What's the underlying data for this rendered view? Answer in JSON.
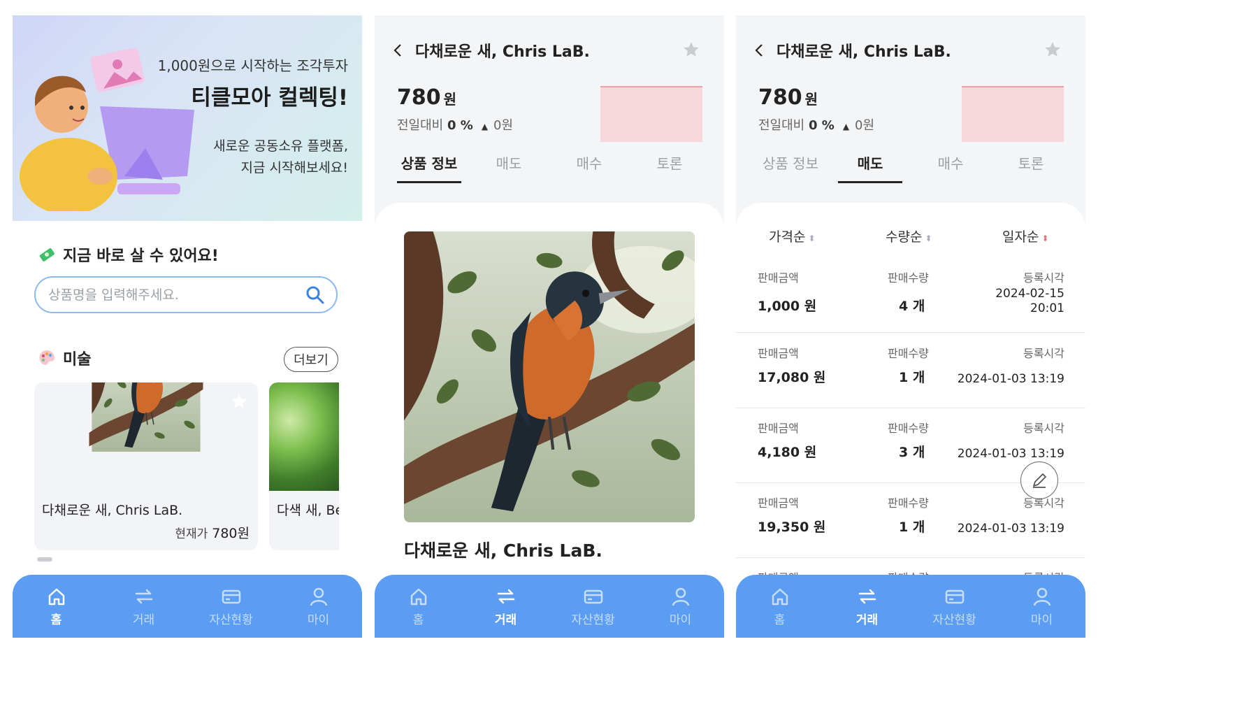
{
  "home": {
    "banner": {
      "kicker": "1,000원으로 시작하는 조각투자",
      "headline": "티클모아 컬렉팅!",
      "desc_line1": "새로운 공동소유 플랫폼,",
      "desc_line2": "지금 시작해보세요!"
    },
    "section_title": "지금 바로 살 수 있어요!",
    "search": {
      "placeholder": "상품명을 입력해주세요."
    },
    "category": {
      "title": "미술",
      "more_label": "더보기"
    },
    "cards": [
      {
        "name": "다채로운 새, Chris LaB.",
        "price_label": "현재가",
        "price": "780원"
      },
      {
        "name": "다색 새, Be"
      }
    ]
  },
  "detail": {
    "title": "다채로운 새, Chris LaB.",
    "price": "780",
    "price_unit": "원",
    "change_label": "전일대비",
    "change_pct": "0 %",
    "change_amount": "0원",
    "tabs": [
      "상품 정보",
      "매도",
      "매수",
      "토론"
    ],
    "artwork_title": "다채로운 새, Chris LaB."
  },
  "sell": {
    "sort": [
      "가격순",
      "수량순",
      "일자순"
    ],
    "col_labels": {
      "amount": "판매금액",
      "qty": "판매수량",
      "time": "등록시각"
    },
    "rows": [
      {
        "amount": "1,000 원",
        "qty": "4 개",
        "date": "2024-02-15",
        "time": "20:01"
      },
      {
        "amount": "17,080 원",
        "qty": "1 개",
        "date": "2024-01-03 13:19"
      },
      {
        "amount": "4,180 원",
        "qty": "3 개",
        "date": "2024-01-03 13:19"
      },
      {
        "amount": "19,350 원",
        "qty": "1 개",
        "date": "2024-01-03 13:19"
      }
    ]
  },
  "nav": [
    {
      "label": "홈",
      "icon": "home-icon"
    },
    {
      "label": "거래",
      "icon": "swap-icon"
    },
    {
      "label": "자산현황",
      "icon": "wallet-icon"
    },
    {
      "label": "마이",
      "icon": "user-icon"
    }
  ],
  "colors": {
    "tabbar": "#5b9df2",
    "search_border": "#8ab9f2",
    "chart_fill": "#f6d8da",
    "chart_line": "#f09da3"
  }
}
